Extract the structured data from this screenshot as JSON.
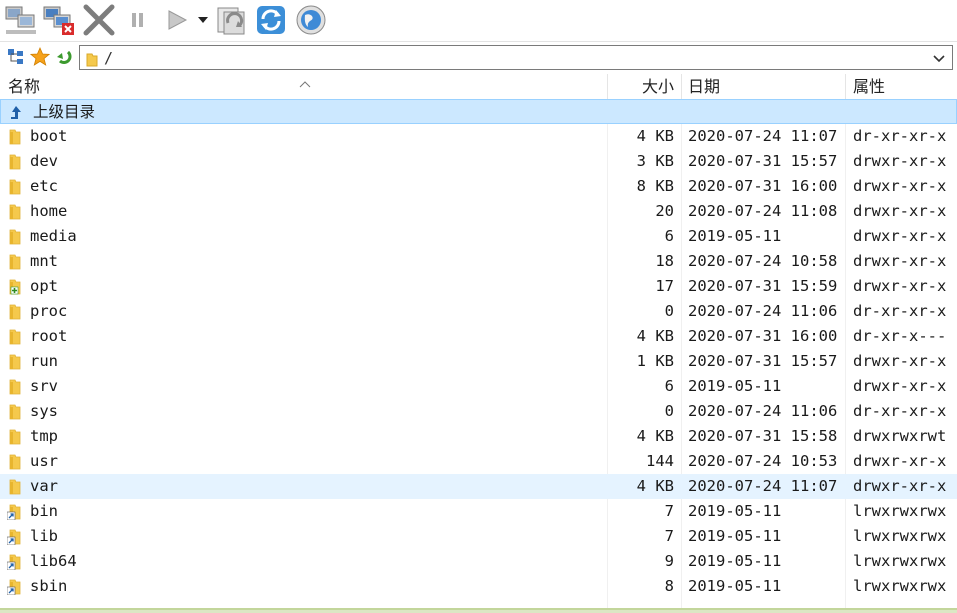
{
  "address": {
    "path": "/"
  },
  "columns": {
    "name": "名称",
    "size": "大小",
    "date": "日期",
    "attr": "属性"
  },
  "parent_row": {
    "label": "上级目录"
  },
  "rows": [
    {
      "name": "boot",
      "size": "4 KB",
      "date": "2020-07-24 11:07",
      "attr": "dr-xr-xr-x",
      "icon": "folder-icon"
    },
    {
      "name": "dev",
      "size": "3 KB",
      "date": "2020-07-31 15:57",
      "attr": "drwxr-xr-x",
      "icon": "folder-icon"
    },
    {
      "name": "etc",
      "size": "8 KB",
      "date": "2020-07-31 16:00",
      "attr": "drwxr-xr-x",
      "icon": "folder-icon"
    },
    {
      "name": "home",
      "size": "20",
      "date": "2020-07-24 11:08",
      "attr": "drwxr-xr-x",
      "icon": "folder-icon"
    },
    {
      "name": "media",
      "size": "6",
      "date": "2019-05-11",
      "attr": "drwxr-xr-x",
      "icon": "folder-icon"
    },
    {
      "name": "mnt",
      "size": "18",
      "date": "2020-07-24 10:58",
      "attr": "drwxr-xr-x",
      "icon": "folder-icon"
    },
    {
      "name": "opt",
      "size": "17",
      "date": "2020-07-31 15:59",
      "attr": "drwxr-xr-x",
      "icon": "folder-plus-icon"
    },
    {
      "name": "proc",
      "size": "0",
      "date": "2020-07-24 11:06",
      "attr": "dr-xr-xr-x",
      "icon": "folder-icon"
    },
    {
      "name": "root",
      "size": "4 KB",
      "date": "2020-07-31 16:00",
      "attr": "dr-xr-x---",
      "icon": "folder-icon"
    },
    {
      "name": "run",
      "size": "1 KB",
      "date": "2020-07-31 15:57",
      "attr": "drwxr-xr-x",
      "icon": "folder-icon"
    },
    {
      "name": "srv",
      "size": "6",
      "date": "2019-05-11",
      "attr": "drwxr-xr-x",
      "icon": "folder-icon"
    },
    {
      "name": "sys",
      "size": "0",
      "date": "2020-07-24 11:06",
      "attr": "dr-xr-xr-x",
      "icon": "folder-icon"
    },
    {
      "name": "tmp",
      "size": "4 KB",
      "date": "2020-07-31 15:58",
      "attr": "drwxrwxrwt",
      "icon": "folder-icon"
    },
    {
      "name": "usr",
      "size": "144",
      "date": "2020-07-24 10:53",
      "attr": "drwxr-xr-x",
      "icon": "folder-icon"
    },
    {
      "name": "var",
      "size": "4 KB",
      "date": "2020-07-24 11:07",
      "attr": "drwxr-xr-x",
      "icon": "folder-icon",
      "hover": true
    },
    {
      "name": "bin",
      "size": "7",
      "date": "2019-05-11",
      "attr": "lrwxrwxrwx",
      "icon": "folder-link-icon"
    },
    {
      "name": "lib",
      "size": "7",
      "date": "2019-05-11",
      "attr": "lrwxrwxrwx",
      "icon": "folder-link-icon"
    },
    {
      "name": "lib64",
      "size": "9",
      "date": "2019-05-11",
      "attr": "lrwxrwxrwx",
      "icon": "folder-link-icon"
    },
    {
      "name": "sbin",
      "size": "8",
      "date": "2019-05-11",
      "attr": "lrwxrwxrwx",
      "icon": "folder-link-icon"
    }
  ],
  "colors": {
    "selected_row": "#cce8ff",
    "hover_row": "#e5f3ff",
    "folder": "#f5c94c"
  }
}
